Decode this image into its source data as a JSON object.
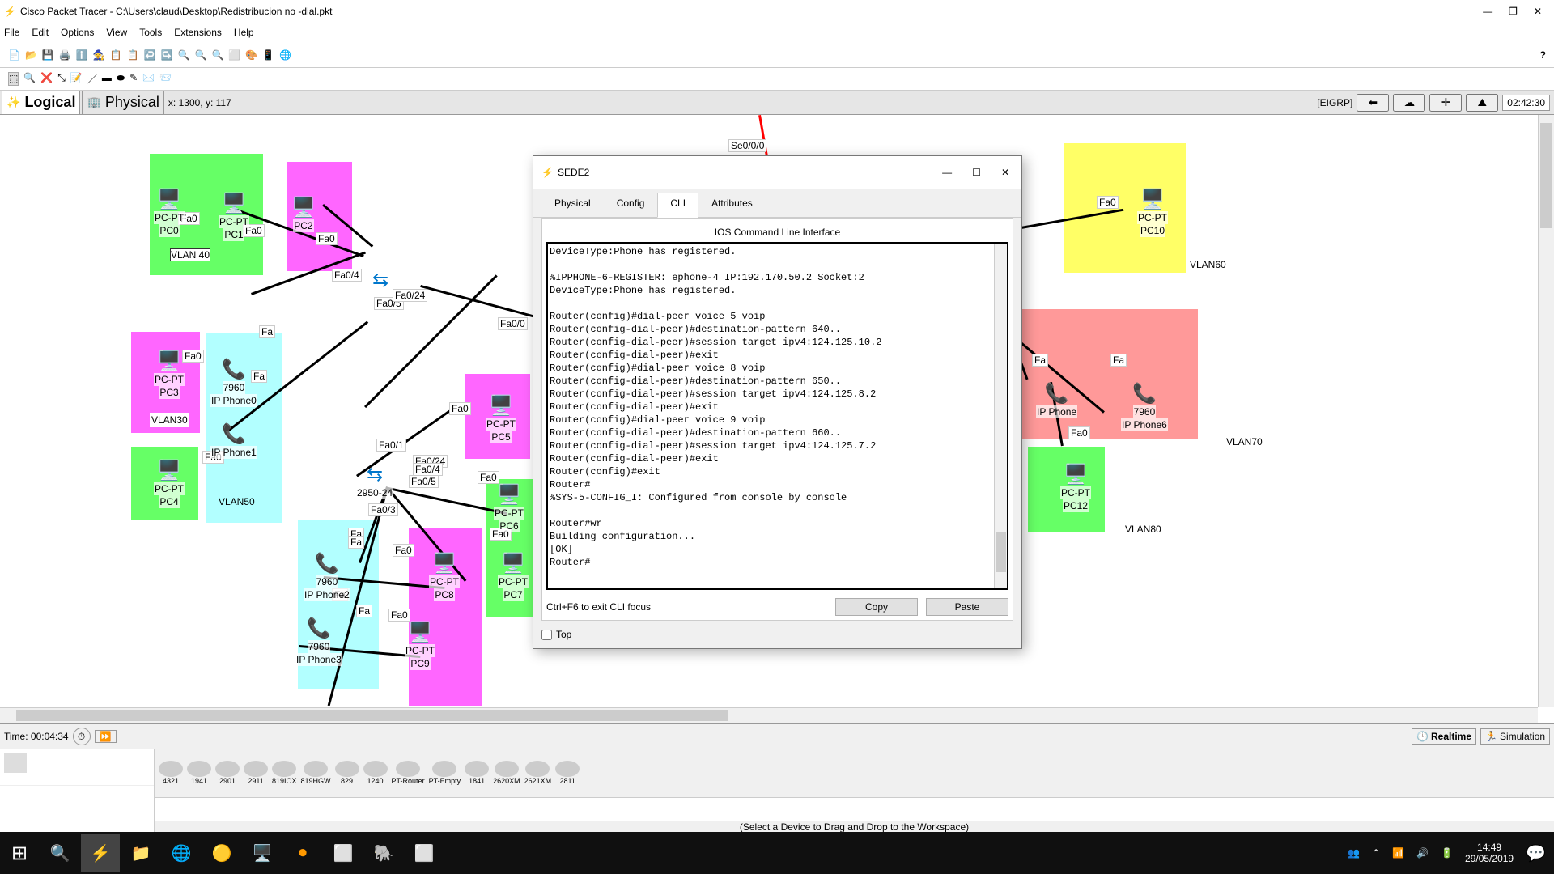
{
  "app": {
    "title": "Cisco Packet Tracer - C:\\Users\\claud\\Desktop\\Redistribucion no -dial.pkt",
    "menu": [
      "File",
      "Edit",
      "Options",
      "View",
      "Tools",
      "Extensions",
      "Help"
    ]
  },
  "logic_bar": {
    "logical_label": "Logical",
    "physical_label": "Physical",
    "coordinates": "x: 1300, y: 117",
    "protocol": "[EIGRP]",
    "timer": "02:42:30"
  },
  "dialog": {
    "title": "SEDE2",
    "tabs": [
      "Physical",
      "Config",
      "CLI",
      "Attributes"
    ],
    "header": "IOS Command Line Interface",
    "cli_content": "DeviceType:Phone has registered.\n\n%IPPHONE-6-REGISTER: ephone-4 IP:192.170.50.2 Socket:2\nDeviceType:Phone has registered.\n\nRouter(config)#dial-peer voice 5 voip\nRouter(config-dial-peer)#destination-pattern 640..\nRouter(config-dial-peer)#session target ipv4:124.125.10.2\nRouter(config-dial-peer)#exit\nRouter(config)#dial-peer voice 8 voip\nRouter(config-dial-peer)#destination-pattern 650..\nRouter(config-dial-peer)#session target ipv4:124.125.8.2\nRouter(config-dial-peer)#exit\nRouter(config)#dial-peer voice 9 voip\nRouter(config-dial-peer)#destination-pattern 660..\nRouter(config-dial-peer)#session target ipv4:124.125.7.2\nRouter(config-dial-peer)#exit\nRouter(config)#exit\nRouter#\n%SYS-5-CONFIG_I: Configured from console by console\n\nRouter#wr\nBuilding configuration...\n[OK]\nRouter#",
    "footer_hint": "Ctrl+F6 to exit CLI focus",
    "btn_copy": "Copy",
    "btn_paste": "Paste",
    "checkbox_top": "Top"
  },
  "workspace": {
    "labels": {
      "vlan40": "VLAN 40",
      "vlan30": "VLAN30",
      "vlan50": "VLAN50",
      "vlan60": "VLAN60",
      "vlan70": "VLAN70",
      "vlan80": "VLAN80",
      "se0": "Se0/0/0",
      "fa00": "Fa0/0",
      "fa01": "Fa0/1",
      "fa04": "Fa0/4",
      "fa05": "Fa0/5",
      "fa03": "Fa0/3",
      "fa0_24": "Fa0/24",
      "switch_2950": "2950-24",
      "fa0": "Fa0",
      "fa": "Fa",
      "fa05_top": "Fa0/5",
      "fa04_top": "Fa0/4",
      "fa0_24_top": "Fa0/24",
      "fa04_mid": "Fa0/4",
      "fa024_mid": "Fa0/24"
    },
    "devices": {
      "pc0": "PC0",
      "pc0_type": "PC-PT",
      "pc1": "PC1",
      "pc1_type": "PC-PT",
      "pc2": "PC2",
      "pc3": "PC3",
      "pc3_type": "PC-PT",
      "pc4": "PC4",
      "pc4_type": "PC-PT",
      "pc5": "PC5",
      "pc5_type": "PC-PT",
      "pc6": "PC6",
      "pc6_type": "PC-PT",
      "pc7": "PC7",
      "pc7_type": "PC-PT",
      "pc8": "PC8",
      "pc8_type": "PC-PT",
      "pc9": "PC9",
      "pc9_type": "PC-PT",
      "pc10": "PC10",
      "pc10_type": "PC-PT",
      "pc12": "PC12",
      "pc12_type": "PC-PT",
      "ip0": "IP Phone0",
      "ip1": "IP Phone1",
      "ip2": "IP Phone2",
      "ip3": "IP Phone3",
      "ip6": "IP Phone6",
      "ip_generic": "IP Phone",
      "phone_model": "7960"
    }
  },
  "bottom": {
    "time_label": "Time: 00:04:34",
    "realtime": "Realtime",
    "simulation": "Simulation",
    "status": "(Select a Device to Drag and Drop to the Workspace)",
    "models": [
      "4321",
      "1941",
      "2901",
      "2911",
      "819IOX",
      "819HGW",
      "829",
      "1240",
      "PT-Router",
      "PT-Empty",
      "1841",
      "2620XM",
      "2621XM",
      "2811"
    ]
  },
  "taskbar": {
    "time": "14:49",
    "date": "29/05/2019"
  }
}
